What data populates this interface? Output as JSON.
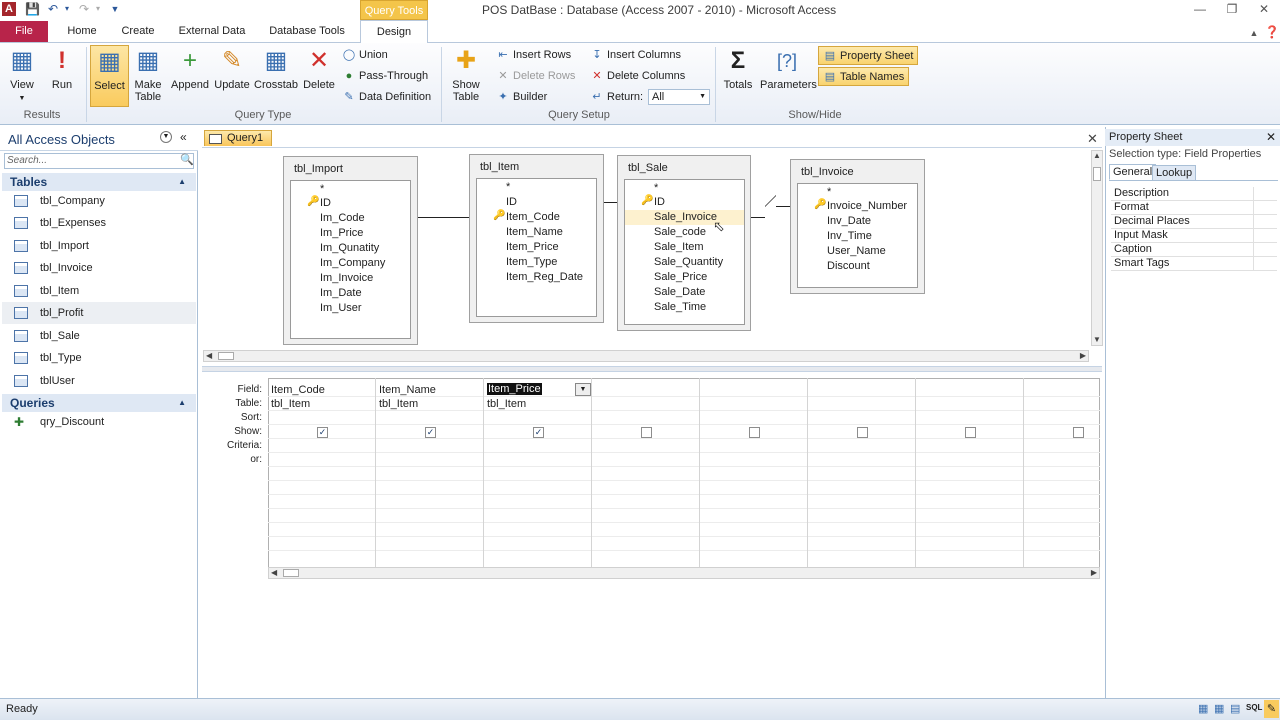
{
  "title_bar": {
    "app_icon": "A",
    "context_tab": "Query Tools",
    "window_title": "POS DatBase : Database (Access 2007 - 2010)  -  Microsoft Access"
  },
  "tabs": [
    "File",
    "Home",
    "Create",
    "External Data",
    "Database Tools",
    "Design"
  ],
  "ribbon": {
    "results": {
      "label": "Results",
      "view": "View",
      "run": "Run"
    },
    "query_type": {
      "label": "Query Type",
      "select": "Select",
      "make_table_1": "Make",
      "make_table_2": "Table",
      "append": "Append",
      "update": "Update",
      "crosstab": "Crosstab",
      "delete": "Delete",
      "union": "Union",
      "pass_through": "Pass-Through",
      "data_definition": "Data Definition"
    },
    "query_setup": {
      "label": "Query Setup",
      "show_table_1": "Show",
      "show_table_2": "Table",
      "insert_rows": "Insert Rows",
      "delete_rows": "Delete Rows",
      "builder": "Builder",
      "insert_columns": "Insert Columns",
      "delete_columns": "Delete Columns",
      "return_label": "Return:",
      "return_value": "All"
    },
    "show_hide": {
      "label": "Show/Hide",
      "totals": "Totals",
      "parameters": "Parameters",
      "property_sheet": "Property Sheet",
      "table_names": "Table Names"
    }
  },
  "nav": {
    "header": "All Access Objects",
    "search_placeholder": "Search...",
    "tables_label": "Tables",
    "tables": [
      "tbl_Company",
      "tbl_Expenses",
      "tbl_Import",
      "tbl_Invoice",
      "tbl_Item",
      "tbl_Profit",
      "tbl_Sale",
      "tbl_Type",
      "tblUser"
    ],
    "queries_label": "Queries",
    "queries": [
      "qry_Discount"
    ]
  },
  "document": {
    "tab_label": "Query1",
    "tables": [
      {
        "name": "tbl_Import",
        "fields": [
          "*",
          "ID",
          "Im_Code",
          "Im_Price",
          "Im_Qunatity",
          "Im_Company",
          "Im_Invoice",
          "Im_Date",
          "Im_User"
        ]
      },
      {
        "name": "tbl_Item",
        "fields": [
          "*",
          "ID",
          "Item_Code",
          "Item_Name",
          "Item_Price",
          "Item_Type",
          "Item_Reg_Date"
        ]
      },
      {
        "name": "tbl_Sale",
        "fields": [
          "*",
          "ID",
          "Sale_Invoice",
          "Sale_code",
          "Sale_Item",
          "Sale_Quantity",
          "Sale_Price",
          "Sale_Date",
          "Sale_Time"
        ]
      },
      {
        "name": "tbl_Invoice",
        "fields": [
          "*",
          "Invoice_Number",
          "Inv_Date",
          "Inv_Time",
          "User_Name",
          "Discount"
        ]
      }
    ],
    "grid": {
      "row_labels": [
        "Field:",
        "Table:",
        "Sort:",
        "Show:",
        "Criteria:",
        "or:"
      ],
      "columns": [
        {
          "field": "Item_Code",
          "table": "tbl_Item",
          "show": true
        },
        {
          "field": "Item_Name",
          "table": "tbl_Item",
          "show": true
        },
        {
          "field": "Item_Price",
          "table": "tbl_Item",
          "show": true
        },
        {
          "field": "",
          "table": "",
          "show": false
        },
        {
          "field": "",
          "table": "",
          "show": false
        },
        {
          "field": "",
          "table": "",
          "show": false
        },
        {
          "field": "",
          "table": "",
          "show": false
        },
        {
          "field": "",
          "table": "",
          "show": false
        }
      ]
    }
  },
  "property_sheet": {
    "title": "Property Sheet",
    "selection_type": "Selection type:  Field Properties",
    "tab_general": "General",
    "tab_lookup": "Lookup",
    "properties": [
      "Description",
      "Format",
      "Decimal Places",
      "Input Mask",
      "Caption",
      "Smart Tags"
    ]
  },
  "status": {
    "text": "Ready",
    "views_icons": [
      "datasheet-view-icon",
      "pivottable-view-icon",
      "pivotchart-view-icon",
      "sql-view-icon",
      "design-view-icon"
    ]
  },
  "colors": {
    "file_tab": "#b8244a",
    "context_tab": "#f4c54a",
    "accent_blue": "#2b579a"
  }
}
